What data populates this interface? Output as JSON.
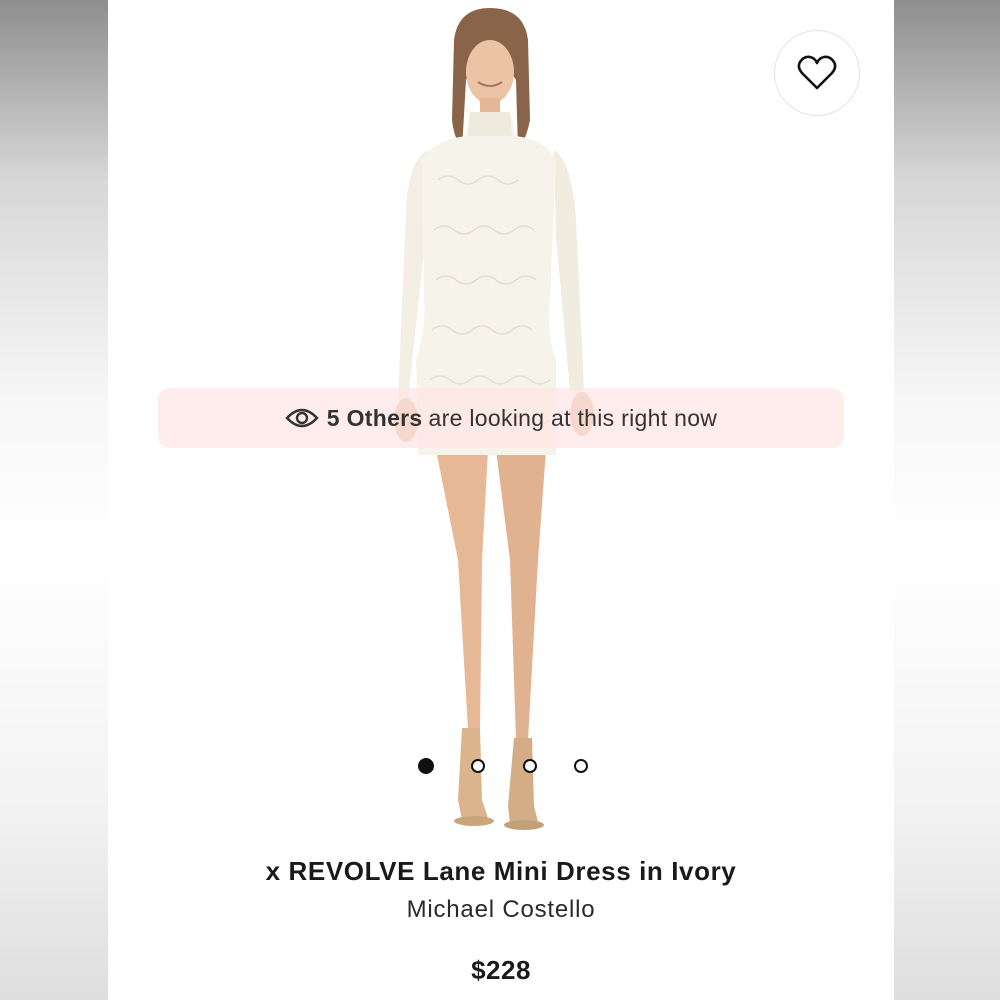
{
  "viewers_banner": {
    "count_text": "5 Others",
    "suffix_text": "are looking at this right now",
    "icon": "eye-icon"
  },
  "favorite": {
    "icon": "heart-icon"
  },
  "gallery": {
    "total_images": 4,
    "active_index": 1
  },
  "product": {
    "title": "x REVOLVE Lane Mini Dress in Ivory",
    "brand": "Michael Costello",
    "price": "$228"
  },
  "colors": {
    "banner_bg": "#ffe4e4",
    "dress": "#f6f3ea",
    "skin": "#e9bf9f",
    "text": "#1a1a1a"
  }
}
